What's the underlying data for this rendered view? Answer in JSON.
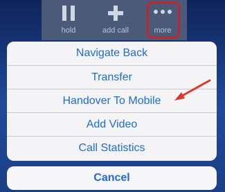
{
  "toolbar": {
    "buttons": [
      {
        "label": "hold",
        "icon": "pause-icon"
      },
      {
        "label": "add call",
        "icon": "plus-icon"
      },
      {
        "label": "more",
        "icon": "more-dots-icon"
      }
    ]
  },
  "action_sheet": {
    "items": [
      "Navigate Back",
      "Transfer",
      "Handover To Mobile",
      "Add Video",
      "Call Statistics"
    ],
    "cancel_label": "Cancel"
  },
  "colors": {
    "accent": "#1d6bd9",
    "highlight": "#c0262a",
    "toolbar": "#4a5a78",
    "sheet": "#f4f4f6"
  }
}
